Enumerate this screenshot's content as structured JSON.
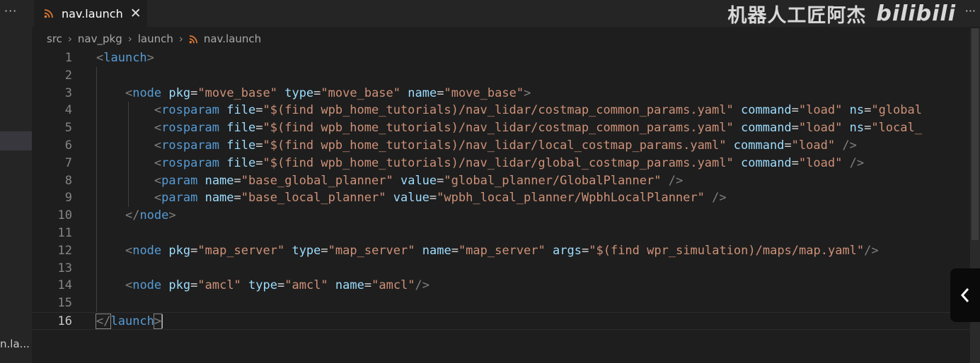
{
  "sidebar": {
    "more_label": "···",
    "file_label": "n.la..."
  },
  "tab": {
    "label": "nav.launch",
    "close_label": "✕"
  },
  "watermark": {
    "text": "机器人工匠阿杰",
    "brand": "bilibili"
  },
  "more_actions": "···",
  "breadcrumb": [
    "src",
    "nav_pkg",
    "launch",
    "nav.launch"
  ],
  "editor": {
    "active_line": 16,
    "lines": [
      {
        "n": "1",
        "tokens": [
          [
            "p",
            "<"
          ],
          [
            "t",
            "launch"
          ],
          [
            "p",
            ">"
          ]
        ]
      },
      {
        "n": "2",
        "tokens": []
      },
      {
        "n": "3",
        "tokens": [
          [
            "s",
            "    "
          ],
          [
            "p",
            "<"
          ],
          [
            "t",
            "node"
          ],
          [
            "s",
            " "
          ],
          [
            "a",
            "pkg"
          ],
          [
            "e",
            "="
          ],
          [
            "v",
            "\"move_base\""
          ],
          [
            "s",
            " "
          ],
          [
            "a",
            "type"
          ],
          [
            "e",
            "="
          ],
          [
            "v",
            "\"move_base\""
          ],
          [
            "s",
            " "
          ],
          [
            "a",
            "name"
          ],
          [
            "e",
            "="
          ],
          [
            "v",
            "\"move_base\""
          ],
          [
            "p",
            ">"
          ]
        ]
      },
      {
        "n": "4",
        "tokens": [
          [
            "s",
            "        "
          ],
          [
            "p",
            "<"
          ],
          [
            "t",
            "rosparam"
          ],
          [
            "s",
            " "
          ],
          [
            "a",
            "file"
          ],
          [
            "e",
            "="
          ],
          [
            "v",
            "\"$(find wpb_home_tutorials)/nav_lidar/costmap_common_params.yaml\""
          ],
          [
            "s",
            " "
          ],
          [
            "a",
            "command"
          ],
          [
            "e",
            "="
          ],
          [
            "v",
            "\"load\""
          ],
          [
            "s",
            " "
          ],
          [
            "a",
            "ns"
          ],
          [
            "e",
            "="
          ],
          [
            "v",
            "\"global"
          ]
        ]
      },
      {
        "n": "5",
        "tokens": [
          [
            "s",
            "        "
          ],
          [
            "p",
            "<"
          ],
          [
            "t",
            "rosparam"
          ],
          [
            "s",
            " "
          ],
          [
            "a",
            "file"
          ],
          [
            "e",
            "="
          ],
          [
            "v",
            "\"$(find wpb_home_tutorials)/nav_lidar/costmap_common_params.yaml\""
          ],
          [
            "s",
            " "
          ],
          [
            "a",
            "command"
          ],
          [
            "e",
            "="
          ],
          [
            "v",
            "\"load\""
          ],
          [
            "s",
            " "
          ],
          [
            "a",
            "ns"
          ],
          [
            "e",
            "="
          ],
          [
            "v",
            "\"local_"
          ]
        ]
      },
      {
        "n": "6",
        "tokens": [
          [
            "s",
            "        "
          ],
          [
            "p",
            "<"
          ],
          [
            "t",
            "rosparam"
          ],
          [
            "s",
            " "
          ],
          [
            "a",
            "file"
          ],
          [
            "e",
            "="
          ],
          [
            "v",
            "\"$(find wpb_home_tutorials)/nav_lidar/local_costmap_params.yaml\""
          ],
          [
            "s",
            " "
          ],
          [
            "a",
            "command"
          ],
          [
            "e",
            "="
          ],
          [
            "v",
            "\"load\""
          ],
          [
            "s",
            " "
          ],
          [
            "p",
            "/>"
          ]
        ]
      },
      {
        "n": "7",
        "tokens": [
          [
            "s",
            "        "
          ],
          [
            "p",
            "<"
          ],
          [
            "t",
            "rosparam"
          ],
          [
            "s",
            " "
          ],
          [
            "a",
            "file"
          ],
          [
            "e",
            "="
          ],
          [
            "v",
            "\"$(find wpb_home_tutorials)/nav_lidar/global_costmap_params.yaml\""
          ],
          [
            "s",
            " "
          ],
          [
            "a",
            "command"
          ],
          [
            "e",
            "="
          ],
          [
            "v",
            "\"load\""
          ],
          [
            "s",
            " "
          ],
          [
            "p",
            "/>"
          ]
        ]
      },
      {
        "n": "8",
        "tokens": [
          [
            "s",
            "        "
          ],
          [
            "p",
            "<"
          ],
          [
            "t",
            "param"
          ],
          [
            "s",
            " "
          ],
          [
            "a",
            "name"
          ],
          [
            "e",
            "="
          ],
          [
            "v",
            "\"base_global_planner\""
          ],
          [
            "s",
            " "
          ],
          [
            "a",
            "value"
          ],
          [
            "e",
            "="
          ],
          [
            "v",
            "\"global_planner/GlobalPlanner\""
          ],
          [
            "s",
            " "
          ],
          [
            "p",
            "/>"
          ]
        ]
      },
      {
        "n": "9",
        "tokens": [
          [
            "s",
            "        "
          ],
          [
            "p",
            "<"
          ],
          [
            "t",
            "param"
          ],
          [
            "s",
            " "
          ],
          [
            "a",
            "name"
          ],
          [
            "e",
            "="
          ],
          [
            "v",
            "\"base_local_planner\""
          ],
          [
            "s",
            " "
          ],
          [
            "a",
            "value"
          ],
          [
            "e",
            "="
          ],
          [
            "v",
            "\"wpbh_local_planner/WpbhLocalPlanner\""
          ],
          [
            "s",
            " "
          ],
          [
            "p",
            "/>"
          ]
        ]
      },
      {
        "n": "10",
        "tokens": [
          [
            "s",
            "    "
          ],
          [
            "p",
            "</"
          ],
          [
            "t",
            "node"
          ],
          [
            "p",
            ">"
          ]
        ]
      },
      {
        "n": "11",
        "tokens": []
      },
      {
        "n": "12",
        "tokens": [
          [
            "s",
            "    "
          ],
          [
            "p",
            "<"
          ],
          [
            "t",
            "node"
          ],
          [
            "s",
            " "
          ],
          [
            "a",
            "pkg"
          ],
          [
            "e",
            "="
          ],
          [
            "v",
            "\"map_server\""
          ],
          [
            "s",
            " "
          ],
          [
            "a",
            "type"
          ],
          [
            "e",
            "="
          ],
          [
            "v",
            "\"map_server\""
          ],
          [
            "s",
            " "
          ],
          [
            "a",
            "name"
          ],
          [
            "e",
            "="
          ],
          [
            "v",
            "\"map_server\""
          ],
          [
            "s",
            " "
          ],
          [
            "a",
            "args"
          ],
          [
            "e",
            "="
          ],
          [
            "v",
            "\"$(find wpr_simulation)/maps/map.yaml\""
          ],
          [
            "p",
            "/>"
          ]
        ]
      },
      {
        "n": "13",
        "tokens": []
      },
      {
        "n": "14",
        "tokens": [
          [
            "s",
            "    "
          ],
          [
            "p",
            "<"
          ],
          [
            "t",
            "node"
          ],
          [
            "s",
            " "
          ],
          [
            "a",
            "pkg"
          ],
          [
            "e",
            "="
          ],
          [
            "v",
            "\"amcl\""
          ],
          [
            "s",
            " "
          ],
          [
            "a",
            "type"
          ],
          [
            "e",
            "="
          ],
          [
            "v",
            "\"amcl\""
          ],
          [
            "s",
            " "
          ],
          [
            "a",
            "name"
          ],
          [
            "e",
            "="
          ],
          [
            "v",
            "\"amcl\""
          ],
          [
            "p",
            "/>"
          ]
        ]
      },
      {
        "n": "15",
        "tokens": []
      },
      {
        "n": "16",
        "tokens": [
          [
            "p",
            "</"
          ],
          [
            "t",
            "launch"
          ],
          [
            "p",
            ">"
          ]
        ]
      }
    ]
  },
  "collapse_button_icon": "chevron-left-icon"
}
